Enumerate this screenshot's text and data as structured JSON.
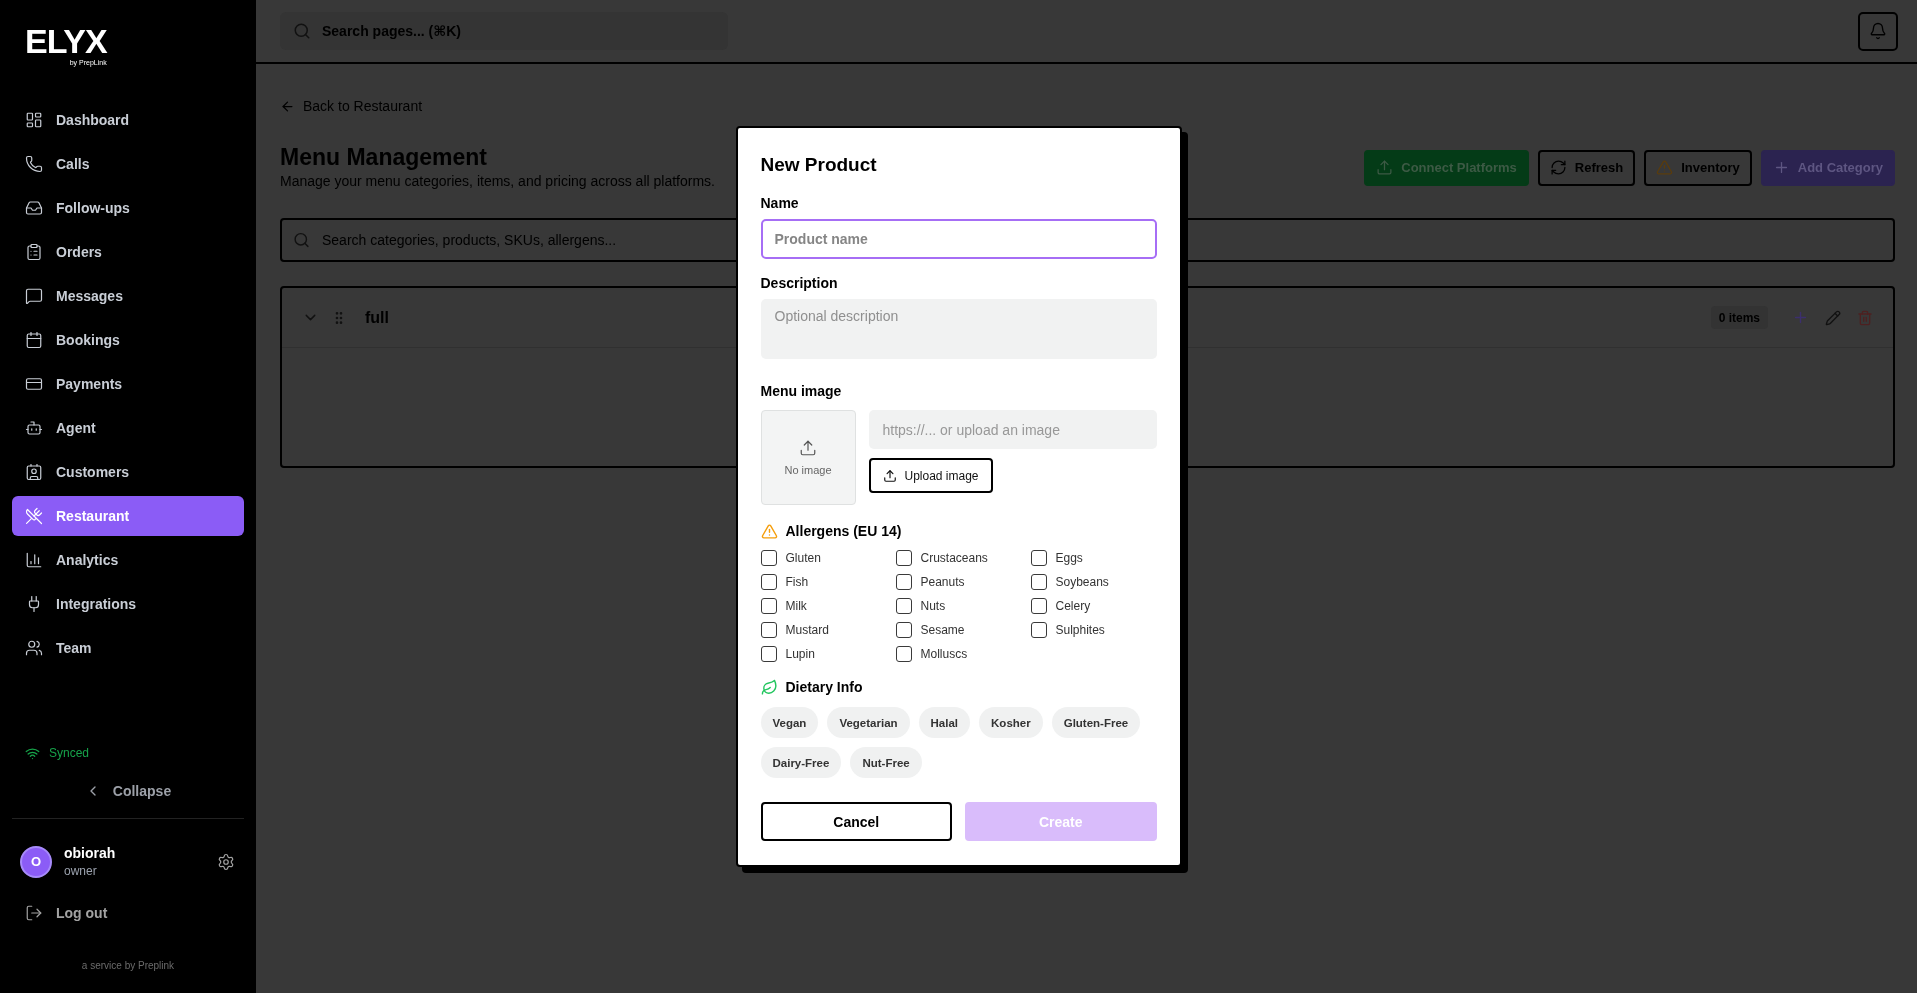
{
  "sidebar": {
    "logo": {
      "wordmark": "ELYX",
      "tagline": "by PrepLink"
    },
    "nav_items": [
      {
        "label": "Dashboard",
        "selected": false
      },
      {
        "label": "Calls",
        "selected": false
      },
      {
        "label": "Follow-ups",
        "selected": false
      },
      {
        "label": "Orders",
        "selected": false
      },
      {
        "label": "Messages",
        "selected": false
      },
      {
        "label": "Bookings",
        "selected": false
      },
      {
        "label": "Payments",
        "selected": false
      },
      {
        "label": "Agent",
        "selected": false
      },
      {
        "label": "Customers",
        "selected": false
      },
      {
        "label": "Restaurant",
        "selected": true
      },
      {
        "label": "Analytics",
        "selected": false
      },
      {
        "label": "Integrations",
        "selected": false
      },
      {
        "label": "Team",
        "selected": false
      }
    ],
    "sync_status": "Synced",
    "collapse": "Collapse",
    "user": {
      "initial": "O",
      "name": "obiorah",
      "role": "owner"
    },
    "logout": "Log out",
    "footer": "a service by Preplink"
  },
  "topbar": {
    "search": {
      "placeholder": "Search pages... (⌘K)"
    }
  },
  "page": {
    "back_link": "Back to Restaurant",
    "title": "Menu Management",
    "subtitle": "Manage your menu categories, items, and pricing across all platforms.",
    "actions": [
      {
        "label": "Connect Platforms",
        "kind": "success"
      },
      {
        "label": "Refresh",
        "kind": "outline"
      },
      {
        "label": "Inventory",
        "kind": "outline"
      },
      {
        "label": "Add Category",
        "kind": "primary"
      }
    ],
    "search": {
      "placeholder": "Search categories, products, SKUs, allergens..."
    },
    "categories": [
      {
        "name": "full",
        "count": "0 items",
        "expanded": true
      }
    ]
  },
  "dialog": {
    "title": "New Product",
    "name_field": {
      "label": "Name",
      "placeholder": "Product name",
      "focused": true
    },
    "description_field": {
      "label": "Description",
      "placeholder": "Optional description"
    },
    "image": {
      "label": "Menu image",
      "preview_text": "No image",
      "url_placeholder": "https://... or upload an image",
      "upload_button": "Upload image"
    },
    "allergens": {
      "title": "Allergens (EU 14)",
      "items": [
        {
          "label": "Gluten",
          "checked": false
        },
        {
          "label": "Crustaceans",
          "checked": false
        },
        {
          "label": "Eggs",
          "checked": false
        },
        {
          "label": "Fish",
          "checked": false
        },
        {
          "label": "Peanuts",
          "checked": false
        },
        {
          "label": "Soybeans",
          "checked": false
        },
        {
          "label": "Milk",
          "checked": false
        },
        {
          "label": "Nuts",
          "checked": false
        },
        {
          "label": "Celery",
          "checked": false
        },
        {
          "label": "Mustard",
          "checked": false
        },
        {
          "label": "Sesame",
          "checked": false
        },
        {
          "label": "Sulphites",
          "checked": false
        },
        {
          "label": "Lupin",
          "checked": false
        },
        {
          "label": "Molluscs",
          "checked": false
        }
      ]
    },
    "dietary": {
      "title": "Dietary Info",
      "tags": [
        {
          "label": "Vegan",
          "selected": false
        },
        {
          "label": "Vegetarian",
          "selected": false
        },
        {
          "label": "Halal",
          "selected": false
        },
        {
          "label": "Kosher",
          "selected": false
        },
        {
          "label": "Gluten-Free",
          "selected": false
        },
        {
          "label": "Dairy-Free",
          "selected": false
        },
        {
          "label": "Nut-Free",
          "selected": false
        }
      ]
    },
    "buttons": [
      {
        "label": "Cancel",
        "kind": "secondary",
        "disabled": false
      },
      {
        "label": "Create",
        "kind": "primary",
        "disabled": true
      }
    ]
  }
}
